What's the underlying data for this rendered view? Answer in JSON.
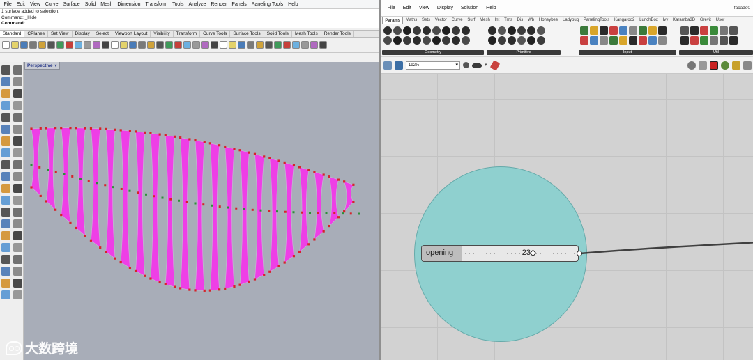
{
  "rhino": {
    "menu": [
      "File",
      "Edit",
      "View",
      "Curve",
      "Surface",
      "Solid",
      "Mesh",
      "Dimension",
      "Transform",
      "Tools",
      "Analyze",
      "Render",
      "Panels",
      "Paneling Tools",
      "Help"
    ],
    "command_history": [
      "1 surface added to selection.",
      "Command: _Hide"
    ],
    "command_prompt": "Command:",
    "toolbar_tabs": [
      "Standard",
      "CPlanes",
      "Set View",
      "Display",
      "Select",
      "Viewport Layout",
      "Visibility",
      "Transform",
      "Curve Tools",
      "Surface Tools",
      "Solid Tools",
      "Mesh Tools",
      "Render Tools"
    ],
    "active_tab": "Standard",
    "viewport_label": "Perspective",
    "viewport_arrow": "▾",
    "colors": {
      "surface": "#ee3fe6",
      "surface_edge": "#c8b8d8",
      "points_red": "#d6232a",
      "points_green": "#2e8f3a",
      "viewport_bg": "#a8adb8"
    }
  },
  "watermark": {
    "text": "大数跨境"
  },
  "grasshopper": {
    "menu": [
      "File",
      "Edit",
      "View",
      "Display",
      "Solution",
      "Help"
    ],
    "document_title": "facade0",
    "tabs": [
      "Params",
      "Maths",
      "Sets",
      "Vector",
      "Curve",
      "Surf",
      "Mesh",
      "Int",
      "Trns",
      "Dis",
      "Wb",
      "Honeybee",
      "Ladybug",
      "PanelingTools",
      "Kangaroo2",
      "LunchBox",
      "Ivy",
      "Karamba3D",
      "Grevit",
      "User"
    ],
    "active_tab": "Params",
    "ribbon_groups": [
      {
        "name": "Geometry"
      },
      {
        "name": "Primitive"
      },
      {
        "name": "Input"
      },
      {
        "name": "Util"
      }
    ],
    "zoom": "192%",
    "slider": {
      "name": "opening",
      "value": "23"
    },
    "colors": {
      "highlight": "#8fd0cf",
      "canvas": "#d2d2d2"
    }
  }
}
